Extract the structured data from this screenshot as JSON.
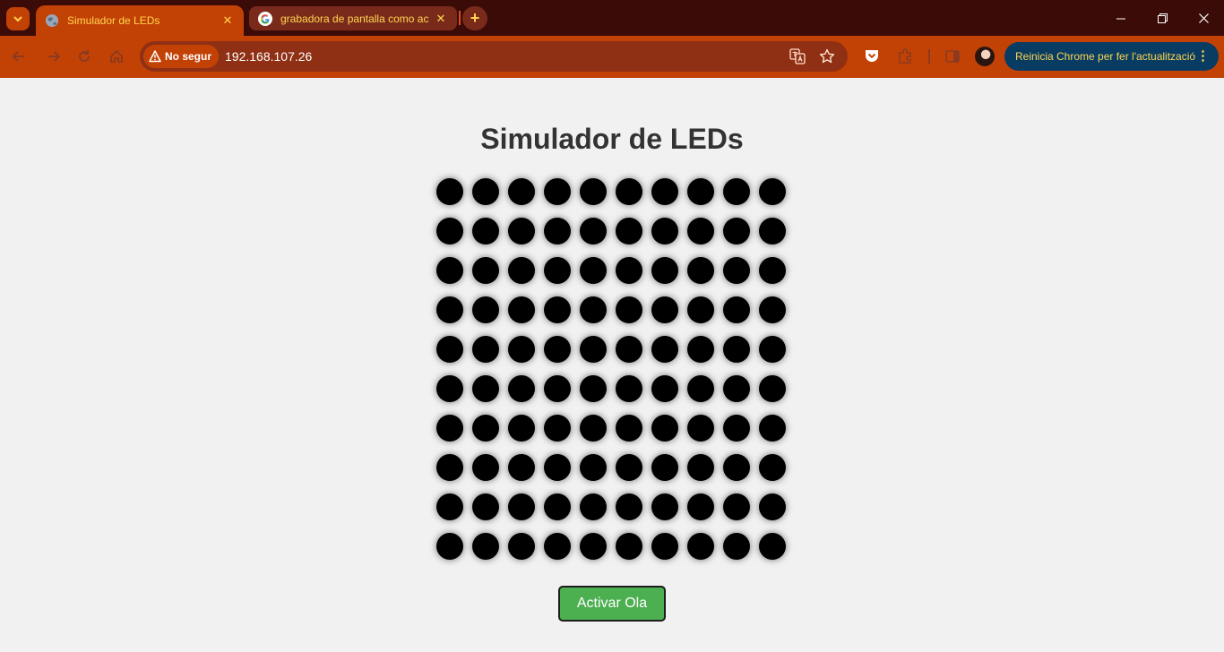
{
  "browser": {
    "tabs": [
      {
        "title": "Simulador de LEDs",
        "active": true,
        "favicon": "globe-icon"
      },
      {
        "title": "grabadora de pantalla como ac",
        "active": false,
        "favicon": "google-g-icon"
      }
    ],
    "new_tab_label": "+",
    "window_controls": {
      "minimize": "—",
      "restore": "❐",
      "close": "✕"
    },
    "security_chip": "No segur",
    "url": "192.168.107.26",
    "update_button": "Reinicia Chrome per fer l'actualització",
    "colors": {
      "tabbar": "#3b0b08",
      "toolbar": "#c24206",
      "omnibox": "#8f2f14",
      "update": "#083c63",
      "accent_text": "#ffd54f"
    }
  },
  "page": {
    "title": "Simulador de LEDs",
    "led_grid": {
      "rows": 10,
      "cols": 10,
      "state": "off",
      "led_color": "#000000"
    },
    "button_label": "Activar Ola",
    "button_color": "#4caf50"
  }
}
